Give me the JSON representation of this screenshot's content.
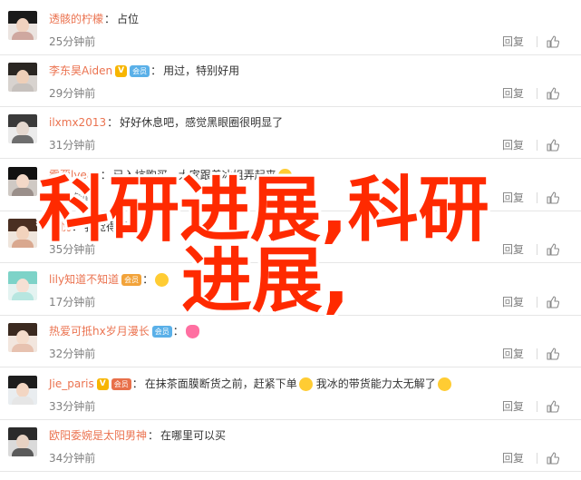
{
  "comments": [
    {
      "user": "透骸的柠檬",
      "has_v": false,
      "vip": "",
      "vip_style": "blue",
      "text": "占位",
      "emoji_after": false,
      "time": "25分钟前",
      "reply": "回复",
      "avatar": {
        "hair": "#1a1a1a",
        "face": "#f0d2bf",
        "body": "#cfa8a0",
        "bg": "#ebe4e0"
      }
    },
    {
      "user": "李东昊Aiden",
      "has_v": true,
      "vip": "会员",
      "vip_style": "blue",
      "text": "用过，特别好用",
      "emoji_after": false,
      "time": "29分钟前",
      "reply": "回复",
      "avatar": {
        "hair": "#2a2622",
        "face": "#eecfb8",
        "body": "#c6c1bd",
        "bg": "#d8d3cf"
      }
    },
    {
      "user": "ilxmx2013",
      "has_v": false,
      "vip": "",
      "vip_style": "blue",
      "text": "好好休息吧，感觉黑眼圈很明显了",
      "emoji_after": false,
      "time": "31分钟前",
      "reply": "回复",
      "avatar": {
        "hair": "#3a3a3a",
        "face": "#e5d8cf",
        "body": "#6e6e6e",
        "bg": "#ebebeb"
      }
    },
    {
      "user": "需要lyeac",
      "has_v": false,
      "vip": "",
      "vip_style": "blue",
      "text": "已入坑购买，大家跟着冰姐弄起来",
      "emoji_after": true,
      "time": "32分钟前",
      "reply": "回复",
      "avatar": {
        "hair": "#111111",
        "face": "#f3d8c7",
        "body": "#9a8f8a",
        "bg": "#cfc9c4"
      }
    },
    {
      "user": "王悦",
      "has_v": false,
      "vip": "",
      "vip_style": "blue",
      "text": "我觉得不错",
      "emoji_after": false,
      "time": "35分钟前",
      "reply": "回复",
      "avatar": {
        "hair": "#4a2f22",
        "face": "#f2d3bd",
        "body": "#d9a88f",
        "bg": "#efe5dc"
      }
    },
    {
      "user": "lily知道不知道",
      "has_v": false,
      "vip": "会员",
      "vip_style": "gold",
      "text": "",
      "emoji_after": true,
      "time": "17分钟前",
      "reply": "回复",
      "avatar": {
        "hair": "#7dd3c8",
        "face": "#f6e0d4",
        "body": "#b7e6e0",
        "bg": "#e4f3f1"
      }
    },
    {
      "user": "热爱可抵hx岁月漫长",
      "has_v": false,
      "vip": "会员",
      "vip_style": "blue",
      "text": "",
      "emoji_after": true,
      "emoji_pink": true,
      "time": "32分钟前",
      "reply": "回复",
      "avatar": {
        "hair": "#3b2a20",
        "face": "#f5dccb",
        "body": "#e7c2b0",
        "bg": "#f2e6de"
      }
    },
    {
      "user": "Jie_paris",
      "has_v": true,
      "vip": "会员",
      "vip_style": "red",
      "text": "在抹茶面膜断货之前，赶紧下单",
      "text2": "我冰的带货能力太无解了",
      "emoji_after": true,
      "time": "33分钟前",
      "reply": "回复",
      "avatar": {
        "hair": "#1d1d1d",
        "face": "#f3d6c3",
        "body": "#e6e6e6",
        "bg": "#e9edf0"
      }
    },
    {
      "user": "欧阳委婉是太阳男神",
      "has_v": false,
      "vip": "",
      "vip_style": "blue",
      "text": "在哪里可以买",
      "emoji_after": false,
      "time": "34分钟前",
      "reply": "回复",
      "avatar": {
        "hair": "#2b2b2b",
        "face": "#e7d2c3",
        "body": "#5a5a5a",
        "bg": "#dadada"
      }
    }
  ],
  "overlay": {
    "line1": "科研进展,科研",
    "line2": "进展,"
  },
  "colors": {
    "username": "#eb7350",
    "meta": "#808080",
    "overlay": "#ff2a00"
  }
}
